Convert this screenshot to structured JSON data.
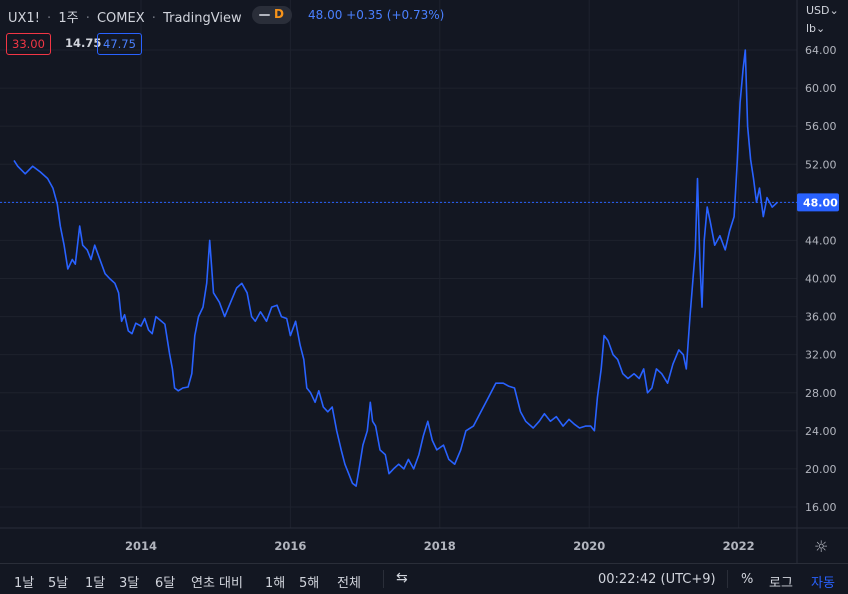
{
  "header": {
    "symbol": "UX1!",
    "interval": "1주",
    "exchange": "COMEX",
    "source": "TradingView",
    "badge": "D",
    "quote": "48.00 +0.35 (+0.73%)"
  },
  "boxes": {
    "bid": "33.00",
    "spread": "14.75",
    "ask": "47.75"
  },
  "axis_controls": {
    "currency": "USD",
    "unit": "lb"
  },
  "bottom_bar": {
    "ranges": [
      "1날",
      "5날",
      "1달",
      "3달",
      "6달",
      "연초 대비",
      "1해",
      "5해",
      "전체"
    ],
    "clock": "00:22:42 (UTC+9)",
    "percent": "%",
    "log": "로그",
    "auto": "자동"
  },
  "colors": {
    "line": "#2962ff",
    "background": "#131722",
    "grid": "#1e222d",
    "last_price_tag": "#2962ff"
  },
  "icons": {
    "calendar": "calendar-goto-icon",
    "settings": "gear-icon"
  },
  "chart_data": {
    "type": "line",
    "title": "",
    "xlabel": "",
    "ylabel": "",
    "x_ticks": [
      "2014",
      "2016",
      "2018",
      "2020",
      "2022"
    ],
    "y_ticks": [
      "64.00",
      "60.00",
      "56.00",
      "52.00",
      "48.00",
      "44.00",
      "40.00",
      "36.00",
      "32.00",
      "28.00",
      "24.00",
      "20.00",
      "16.00"
    ],
    "ylim": [
      12,
      66
    ],
    "xlim": [
      2012.3,
      2022.9
    ],
    "last_price": "48.00",
    "grid": true,
    "series": [
      {
        "values": [
          [
            2012.3,
            52.4
          ],
          [
            2012.35,
            51.8
          ],
          [
            2012.45,
            51.0
          ],
          [
            2012.55,
            51.8
          ],
          [
            2012.65,
            51.2
          ],
          [
            2012.75,
            50.5
          ],
          [
            2012.82,
            49.5
          ],
          [
            2012.88,
            47.8
          ],
          [
            2012.92,
            45.5
          ],
          [
            2012.97,
            43.5
          ],
          [
            2013.02,
            41.0
          ],
          [
            2013.08,
            42.0
          ],
          [
            2013.12,
            41.5
          ],
          [
            2013.18,
            45.5
          ],
          [
            2013.22,
            43.5
          ],
          [
            2013.28,
            43.0
          ],
          [
            2013.33,
            42.0
          ],
          [
            2013.38,
            43.5
          ],
          [
            2013.45,
            42.0
          ],
          [
            2013.52,
            40.5
          ],
          [
            2013.58,
            40.0
          ],
          [
            2013.65,
            39.5
          ],
          [
            2013.7,
            38.5
          ],
          [
            2013.74,
            35.5
          ],
          [
            2013.78,
            36.2
          ],
          [
            2013.83,
            34.5
          ],
          [
            2013.88,
            34.2
          ],
          [
            2013.93,
            35.3
          ],
          [
            2014.0,
            35.0
          ],
          [
            2014.05,
            35.8
          ],
          [
            2014.1,
            34.6
          ],
          [
            2014.15,
            34.2
          ],
          [
            2014.2,
            36.0
          ],
          [
            2014.26,
            35.6
          ],
          [
            2014.32,
            35.2
          ],
          [
            2014.38,
            32.2
          ],
          [
            2014.42,
            30.5
          ],
          [
            2014.45,
            28.5
          ],
          [
            2014.5,
            28.2
          ],
          [
            2014.56,
            28.5
          ],
          [
            2014.63,
            28.6
          ],
          [
            2014.68,
            30.0
          ],
          [
            2014.72,
            34.0
          ],
          [
            2014.77,
            36.0
          ],
          [
            2014.83,
            37.0
          ],
          [
            2014.88,
            39.5
          ],
          [
            2014.92,
            44.0
          ],
          [
            2014.97,
            38.5
          ],
          [
            2015.05,
            37.5
          ],
          [
            2015.12,
            36.0
          ],
          [
            2015.2,
            37.5
          ],
          [
            2015.28,
            39.0
          ],
          [
            2015.35,
            39.5
          ],
          [
            2015.42,
            38.5
          ],
          [
            2015.48,
            36.0
          ],
          [
            2015.53,
            35.5
          ],
          [
            2015.6,
            36.5
          ],
          [
            2015.68,
            35.5
          ],
          [
            2015.75,
            37.0
          ],
          [
            2015.82,
            37.2
          ],
          [
            2015.88,
            36.0
          ],
          [
            2015.95,
            35.8
          ],
          [
            2016.0,
            34.0
          ],
          [
            2016.07,
            35.5
          ],
          [
            2016.13,
            33.0
          ],
          [
            2016.18,
            31.5
          ],
          [
            2016.22,
            28.5
          ],
          [
            2016.27,
            28.0
          ],
          [
            2016.33,
            27.0
          ],
          [
            2016.38,
            28.2
          ],
          [
            2016.44,
            26.5
          ],
          [
            2016.5,
            26.0
          ],
          [
            2016.56,
            26.5
          ],
          [
            2016.62,
            24.0
          ],
          [
            2016.68,
            22.0
          ],
          [
            2016.73,
            20.5
          ],
          [
            2016.78,
            19.5
          ],
          [
            2016.83,
            18.5
          ],
          [
            2016.88,
            18.2
          ],
          [
            2016.92,
            20.0
          ],
          [
            2016.97,
            22.5
          ],
          [
            2017.03,
            24.0
          ],
          [
            2017.07,
            27.0
          ],
          [
            2017.1,
            25.0
          ],
          [
            2017.14,
            24.5
          ],
          [
            2017.2,
            22.0
          ],
          [
            2017.27,
            21.5
          ],
          [
            2017.32,
            19.5
          ],
          [
            2017.38,
            20.0
          ],
          [
            2017.45,
            20.5
          ],
          [
            2017.52,
            20.0
          ],
          [
            2017.58,
            21.0
          ],
          [
            2017.65,
            20.0
          ],
          [
            2017.72,
            21.5
          ],
          [
            2017.78,
            23.5
          ],
          [
            2017.84,
            25.0
          ],
          [
            2017.9,
            23.0
          ],
          [
            2017.96,
            22.0
          ],
          [
            2018.05,
            22.5
          ],
          [
            2018.12,
            21.0
          ],
          [
            2018.2,
            20.5
          ],
          [
            2018.28,
            22.0
          ],
          [
            2018.35,
            24.0
          ],
          [
            2018.45,
            24.5
          ],
          [
            2018.55,
            26.0
          ],
          [
            2018.65,
            27.5
          ],
          [
            2018.75,
            29.0
          ],
          [
            2018.85,
            29.0
          ],
          [
            2018.92,
            28.7
          ],
          [
            2019.0,
            28.5
          ],
          [
            2019.08,
            26.0
          ],
          [
            2019.15,
            25.0
          ],
          [
            2019.25,
            24.3
          ],
          [
            2019.33,
            25.0
          ],
          [
            2019.4,
            25.8
          ],
          [
            2019.48,
            25.0
          ],
          [
            2019.56,
            25.5
          ],
          [
            2019.65,
            24.5
          ],
          [
            2019.73,
            25.2
          ],
          [
            2019.8,
            24.7
          ],
          [
            2019.87,
            24.3
          ],
          [
            2019.95,
            24.5
          ],
          [
            2020.02,
            24.5
          ],
          [
            2020.07,
            24.0
          ],
          [
            2020.11,
            27.5
          ],
          [
            2020.16,
            30.5
          ],
          [
            2020.2,
            34.0
          ],
          [
            2020.25,
            33.5
          ],
          [
            2020.32,
            32.0
          ],
          [
            2020.38,
            31.5
          ],
          [
            2020.45,
            30.0
          ],
          [
            2020.52,
            29.5
          ],
          [
            2020.6,
            30.0
          ],
          [
            2020.67,
            29.5
          ],
          [
            2020.73,
            30.5
          ],
          [
            2020.78,
            28.0
          ],
          [
            2020.84,
            28.5
          ],
          [
            2020.9,
            30.5
          ],
          [
            2020.97,
            30.0
          ],
          [
            2021.05,
            29.0
          ],
          [
            2021.12,
            31.0
          ],
          [
            2021.2,
            32.5
          ],
          [
            2021.26,
            32.0
          ],
          [
            2021.3,
            30.5
          ],
          [
            2021.35,
            36.0
          ],
          [
            2021.42,
            43.0
          ],
          [
            2021.45,
            50.5
          ],
          [
            2021.48,
            42.0
          ],
          [
            2021.51,
            37.0
          ],
          [
            2021.54,
            44.0
          ],
          [
            2021.58,
            47.5
          ],
          [
            2021.62,
            46.0
          ],
          [
            2021.68,
            43.5
          ],
          [
            2021.75,
            44.5
          ],
          [
            2021.82,
            43.0
          ],
          [
            2021.88,
            45.0
          ],
          [
            2021.94,
            46.5
          ],
          [
            2021.98,
            52.0
          ],
          [
            2022.02,
            58.5
          ],
          [
            2022.06,
            62.0
          ],
          [
            2022.09,
            64.0
          ],
          [
            2022.12,
            56.0
          ],
          [
            2022.16,
            52.5
          ],
          [
            2022.2,
            50.5
          ],
          [
            2022.24,
            48.0
          ],
          [
            2022.28,
            49.5
          ],
          [
            2022.33,
            46.5
          ],
          [
            2022.38,
            48.5
          ],
          [
            2022.45,
            47.5
          ],
          [
            2022.52,
            48.0
          ]
        ]
      }
    ]
  }
}
